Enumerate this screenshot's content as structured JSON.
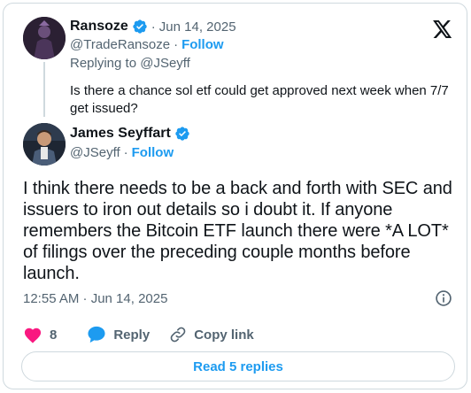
{
  "quoted": {
    "name": "Ransoze",
    "date": "Jun 14, 2025",
    "handle": "@TradeRansoze",
    "follow_label": "Follow",
    "replying_to": "Replying to @JSeyff",
    "text": "Is there a chance sol etf could get approved next week when 7/7 get issued?"
  },
  "tweet": {
    "name": "James Seyffart",
    "handle": "@JSeyff",
    "follow_label": "Follow",
    "text": "I think there needs to be a back and forth with SEC and issuers to iron out details so i doubt it. If anyone remembers the Bitcoin ETF launch there were *A LOT* of filings over the preceding couple months before launch.",
    "timestamp": "12:55 AM · Jun 14, 2025"
  },
  "actions": {
    "like_count": "8",
    "reply_label": "Reply",
    "copy_label": "Copy link"
  },
  "read_replies": "Read 5 replies",
  "colors": {
    "accent": "#1d9bf0",
    "like": "#f91880",
    "text": "#0f1419",
    "muted": "#536471",
    "border": "#cfd9de"
  },
  "icons": [
    "verified-badge-icon",
    "x-logo-icon",
    "info-icon",
    "heart-icon",
    "reply-bubble-icon",
    "link-icon"
  ]
}
